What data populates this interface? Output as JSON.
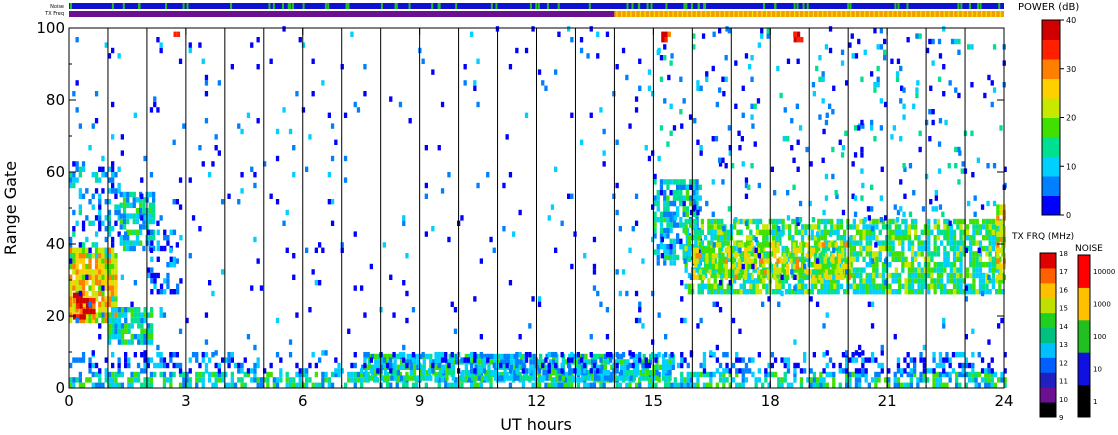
{
  "chart_data": {
    "type": "heatmap",
    "xlabel": "UT hours",
    "ylabel": "Range Gate",
    "xlim": [
      0,
      24
    ],
    "ylim": [
      0,
      100
    ],
    "x_ticks": [
      "0",
      "3",
      "6",
      "9",
      "12",
      "15",
      "18",
      "21",
      "24"
    ],
    "y_ticks": [
      "0",
      "20",
      "40",
      "60",
      "80",
      "100"
    ],
    "vertical_lines_every_hours": 1,
    "top_bars": [
      {
        "name": "Noise",
        "segments": [
          {
            "from": 0,
            "to": 24,
            "color": "#1010d0"
          }
        ],
        "flecks_color": "#20c020"
      },
      {
        "name": "TX Freq",
        "segments": [
          {
            "from": 0,
            "to": 14,
            "color": "#6a1090"
          },
          {
            "from": 14,
            "to": 24,
            "color": "#f0a000"
          }
        ]
      }
    ],
    "power_scale": {
      "title": "POWER (dB)",
      "ticks": [
        "0",
        "10",
        "20",
        "30",
        "40"
      ],
      "colors": [
        "#0000ff",
        "#0080ff",
        "#00d0ff",
        "#00e090",
        "#40e000",
        "#c8e800",
        "#ffd000",
        "#ff8000",
        "#ff2000",
        "#d00000"
      ]
    },
    "txfreq_scale": {
      "title": "TX FRQ (MHz)",
      "ticks": [
        "9",
        "10",
        "11",
        "12",
        "13",
        "14",
        "15",
        "16",
        "17",
        "18"
      ],
      "colors": [
        "#000000",
        "#6a1090",
        "#2020c0",
        "#0060ff",
        "#00c0ff",
        "#00c080",
        "#20d020",
        "#c0e000",
        "#ffc000",
        "#ff6000",
        "#e00000"
      ]
    },
    "noise_scale": {
      "title": "NOISE",
      "ticks": [
        "1",
        "10",
        "100",
        "1000",
        "10000"
      ],
      "colors": [
        "#000000",
        "#1010e0",
        "#20c020",
        "#ffc000",
        "#ff0000"
      ]
    },
    "echo_regions": [
      {
        "t0": 0.0,
        "t1": 1.2,
        "g0": 18,
        "g1": 38,
        "power": 25,
        "density": 0.85
      },
      {
        "t0": 0.1,
        "t1": 0.6,
        "g0": 19,
        "g1": 26,
        "power": 38,
        "density": 0.8
      },
      {
        "t0": 0.0,
        "t1": 1.3,
        "g0": 36,
        "g1": 62,
        "power": 8,
        "density": 0.3
      },
      {
        "t0": 1.0,
        "t1": 2.1,
        "g0": 12,
        "g1": 22,
        "power": 13,
        "density": 0.8
      },
      {
        "t0": 1.3,
        "t1": 2.2,
        "g0": 38,
        "g1": 54,
        "power": 11,
        "density": 0.7
      },
      {
        "t0": 2.0,
        "t1": 2.9,
        "g0": 26,
        "g1": 44,
        "power": 4,
        "density": 0.35
      },
      {
        "t0": 15.0,
        "t1": 16.2,
        "g0": 34,
        "g1": 58,
        "power": 10,
        "density": 0.7
      },
      {
        "t0": 15.8,
        "t1": 24.0,
        "g0": 26,
        "g1": 46,
        "power": 15,
        "density": 0.75
      },
      {
        "t0": 16.0,
        "t1": 20.0,
        "g0": 30,
        "g1": 40,
        "power": 22,
        "density": 0.55
      },
      {
        "t0": 0.0,
        "t1": 24.0,
        "g0": 0,
        "g1": 4,
        "power": 12,
        "density": 0.6
      },
      {
        "t0": 7.5,
        "t1": 15.5,
        "g0": 2,
        "g1": 9,
        "power": 12,
        "density": 0.75
      },
      {
        "t0": 0.0,
        "t1": 24.0,
        "g0": 4,
        "g1": 9,
        "power": 5,
        "density": 0.35
      },
      {
        "t0": 0.0,
        "t1": 24.0,
        "g0": 9,
        "g1": 100,
        "power": 4,
        "density": 0.025
      },
      {
        "t0": 15.0,
        "t1": 24.0,
        "g0": 46,
        "g1": 100,
        "power": 8,
        "density": 0.05
      },
      {
        "t0": 23.8,
        "t1": 24.0,
        "g0": 30,
        "g1": 50,
        "power": 25,
        "density": 0.8
      },
      {
        "t0": 2.6,
        "t1": 2.8,
        "g0": 96,
        "g1": 98,
        "power": 38,
        "density": 0.7
      },
      {
        "t0": 15.2,
        "t1": 15.4,
        "g0": 96,
        "g1": 98,
        "power": 38,
        "density": 0.7
      },
      {
        "t0": 18.6,
        "t1": 18.8,
        "g0": 96,
        "g1": 98,
        "power": 38,
        "density": 0.7
      }
    ]
  }
}
